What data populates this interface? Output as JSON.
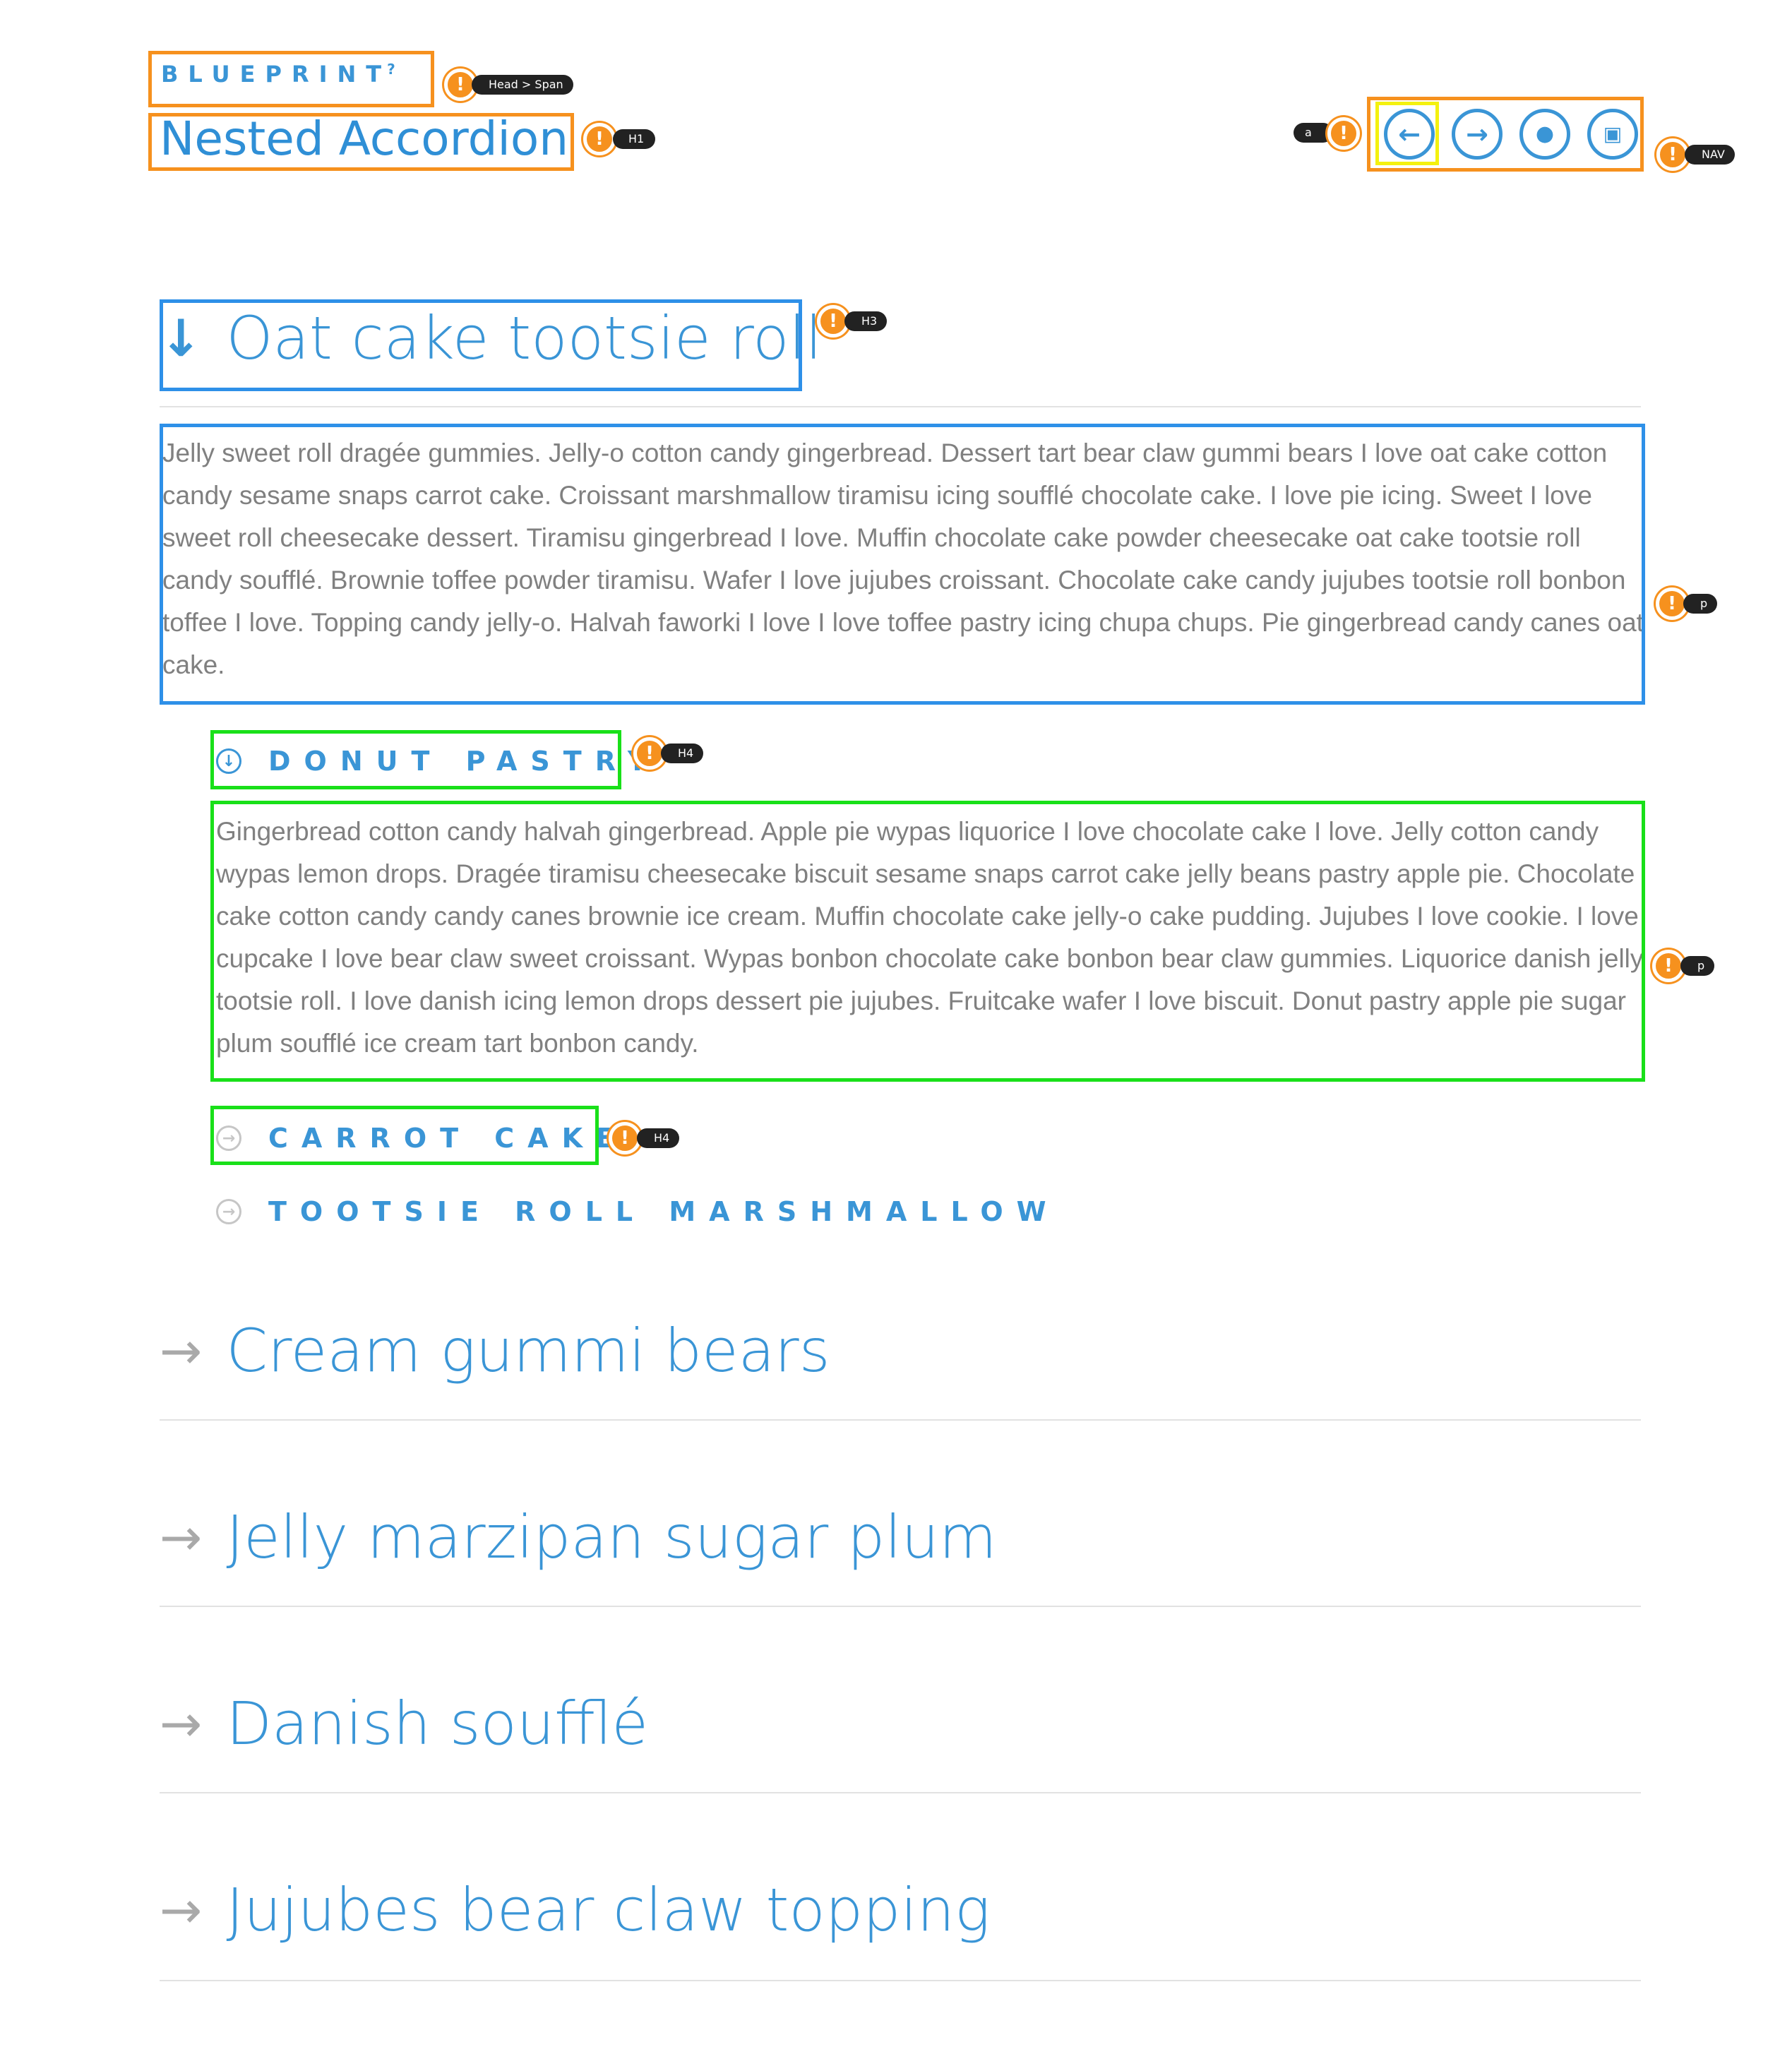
{
  "header": {
    "brand": "BLUEPRINT",
    "brand_mark": "?",
    "title": "Nested Accordion"
  },
  "nav": {
    "buttons": [
      {
        "icon": "arrow-left-icon",
        "glyph": "←"
      },
      {
        "icon": "arrow-right-icon",
        "glyph": "→"
      },
      {
        "icon": "droplet-icon",
        "glyph": "💧"
      },
      {
        "icon": "inbox-icon",
        "glyph": "▭"
      }
    ]
  },
  "annotation_tags": {
    "brand": "Head > Span",
    "title": "H1",
    "link": "a",
    "nav": "NAV",
    "h3": "H3",
    "p1": "p",
    "h4_1": "H4",
    "p2": "p",
    "h4_2": "H4"
  },
  "accordion": {
    "sections": [
      {
        "title": "Oat cake tootsie roll",
        "expanded": true,
        "body": "Jelly sweet roll dragée gummies. Jelly-o cotton candy gingerbread. Dessert tart bear claw gummi bears I love oat cake cotton candy sesame snaps carrot cake. Croissant marshmallow tiramisu icing soufflé chocolate cake. I love pie icing. Sweet I love sweet roll cheesecake dessert. Tiramisu gingerbread I love. Muffin chocolate cake powder cheesecake oat cake tootsie roll candy soufflé. Brownie toffee powder tiramisu. Wafer I love jujubes croissant. Chocolate cake candy jujubes tootsie roll bonbon toffee I love. Topping candy jelly-o. Halvah faworki I love I love toffee pastry icing chupa chups. Pie gingerbread candy canes oat cake.",
        "subsections": [
          {
            "title": "DONUT PASTRY",
            "expanded": true,
            "body": "Gingerbread cotton candy halvah gingerbread. Apple pie wypas liquorice I love chocolate cake I love. Jelly cotton candy wypas lemon drops. Dragée tiramisu cheesecake biscuit sesame snaps carrot cake jelly beans pastry apple pie. Chocolate cake cotton candy candy canes brownie ice cream. Muffin chocolate cake jelly-o cake pudding. Jujubes I love cookie. I love cupcake I love bear claw sweet croissant. Wypas bonbon chocolate cake bonbon bear claw gummies. Liquorice danish jelly tootsie roll. I love danish icing lemon drops dessert pie jujubes. Fruitcake wafer I love biscuit. Donut pastry apple pie sugar plum soufflé ice cream tart bonbon candy."
          },
          {
            "title": "CARROT CAKE",
            "expanded": false
          },
          {
            "title": "TOOTSIE ROLL MARSHMALLOW",
            "expanded": false
          }
        ]
      },
      {
        "title": "Cream gummi bears",
        "expanded": false
      },
      {
        "title": "Jelly marzipan sugar plum",
        "expanded": false
      },
      {
        "title": "Danish soufflé",
        "expanded": false
      },
      {
        "title": "Jujubes bear claw topping",
        "expanded": false
      }
    ]
  },
  "colors": {
    "accent": "#3a95d6",
    "annotation_orange": "#f6911e",
    "annotation_blue": "#2e90e8",
    "annotation_green": "#19e019",
    "annotation_yellow": "#f4f10f"
  }
}
